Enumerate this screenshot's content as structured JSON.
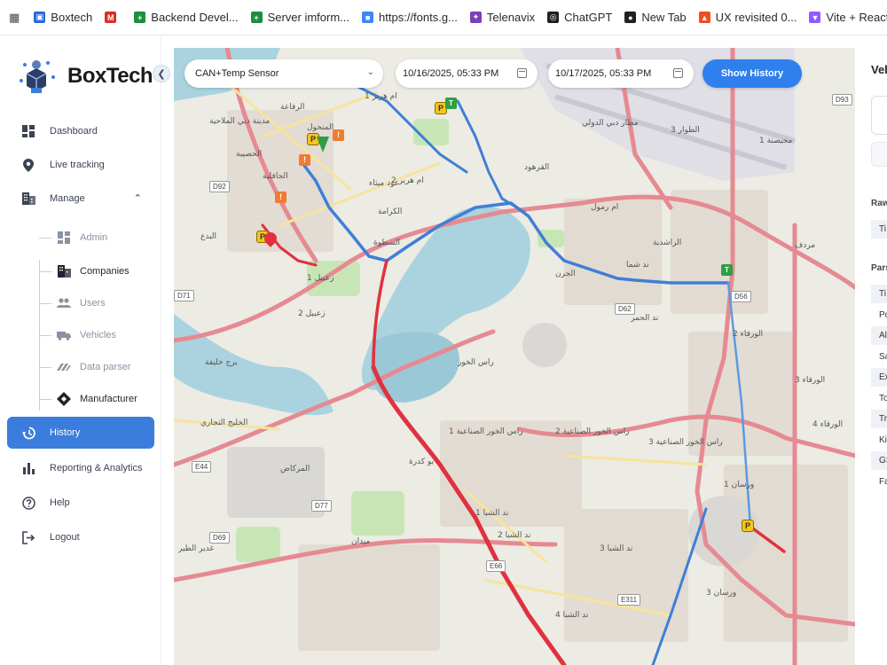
{
  "bookmarks": {
    "items": [
      {
        "label": "Boxtech",
        "color": "#2b6ad9"
      },
      {
        "label": "",
        "color": "#d93025"
      },
      {
        "label": "Backend Devel...",
        "color": "#1e8e3e"
      },
      {
        "label": "Server imform...",
        "color": "#1e8e3e"
      },
      {
        "label": "https://fonts.g...",
        "color": "#4285f4"
      },
      {
        "label": "Telenavix",
        "color": "#7b3fb8"
      },
      {
        "label": "ChatGPT",
        "color": "#202123"
      },
      {
        "label": "New Tab",
        "color": "#202124"
      },
      {
        "label": "UX revisited 0...",
        "color": "#f24e1e"
      },
      {
        "label": "Vite + React",
        "color": "#8d5cff"
      }
    ]
  },
  "brand": {
    "name": "BoxTech",
    "accent": "#3b7ddd"
  },
  "sidebar": {
    "items": [
      {
        "label": "Dashboard",
        "icon": "dashboard-icon"
      },
      {
        "label": "Live tracking",
        "icon": "location-pin-icon"
      },
      {
        "label": "Manage",
        "icon": "building-icon"
      },
      {
        "label": "History",
        "icon": "history-icon"
      },
      {
        "label": "Reporting & Analytics",
        "icon": "bar-chart-icon"
      },
      {
        "label": "Help",
        "icon": "help-icon"
      },
      {
        "label": "Logout",
        "icon": "logout-icon"
      }
    ],
    "manage_children": [
      {
        "label": "Admin",
        "icon": "admin-icon"
      },
      {
        "label": "Companies",
        "icon": "companies-icon"
      },
      {
        "label": "Users",
        "icon": "users-icon"
      },
      {
        "label": "Vehicles",
        "icon": "truck-icon"
      },
      {
        "label": "Data parser",
        "icon": "parser-icon"
      },
      {
        "label": "Manufacturer",
        "icon": "manufacturer-icon"
      }
    ]
  },
  "controls": {
    "sensor_value": "CAN+Temp Sensor",
    "start_date": "10/16/2025, 05:33  PM",
    "end_date": "10/17/2025, 05:33  PM",
    "show_history_label": "Show History"
  },
  "map": {
    "route_colors": {
      "primary": "#3f7fd6",
      "alert": "#e0313f",
      "highway": "#e68a92"
    },
    "labels": [
      "مطار دبي الدولي",
      "القرهود",
      "الراشدية",
      "ند شما",
      "الجرن",
      "ند الحمر",
      "أم رمول",
      "زعبيل 1",
      "زعبيل 2",
      "الجافلية",
      "المنخول",
      "الرفاعة",
      "عود ميثاء",
      "أم هرير 1",
      "أم هرير 2",
      "الكرامة",
      "السطوة",
      "الخليج التجاري",
      "برج خليفة",
      "المركاض",
      "ميدان",
      "ند الشبا 1",
      "ند الشبا 2",
      "ند الشبا 3",
      "ند الشبا 4",
      "رأس الخور",
      "رأس الخور الصناعية 1",
      "رأس الخور الصناعية 2",
      "رأس الخور الصناعية 3",
      "ورسان 1",
      "ورسان 3",
      "الورقاء 2",
      "الورقاء 3",
      "الورقاء 4",
      "محيصنة 1",
      "الطوار 3",
      "مردف",
      "غدير الطير",
      "البدع",
      "الحصيبة",
      "مدينة دبي الملاحية",
      "بو كدرة"
    ],
    "roads": [
      "D92",
      "D71",
      "D69",
      "D77",
      "D62",
      "D56",
      "D93",
      "E44",
      "E311",
      "E66"
    ]
  },
  "right_panel": {
    "title": "Vel",
    "raw_heading": "Raw",
    "raw_row": "Ti",
    "parsed_heading": "Pars",
    "parsed_rows": [
      "Ti",
      "Po",
      "Al",
      "Sa",
      "Ex",
      "To",
      "Tr",
      "Ki",
      "GS",
      "Fa"
    ]
  }
}
